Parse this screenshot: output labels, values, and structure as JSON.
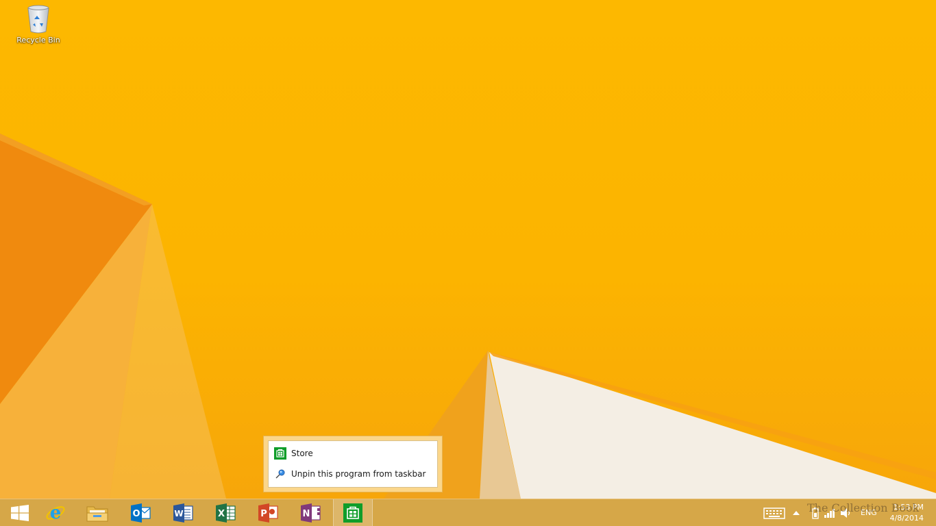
{
  "desktop": {
    "icons": [
      {
        "label": "Recycle Bin",
        "icon": "recycle-bin-icon"
      }
    ]
  },
  "jumplist": {
    "items": [
      {
        "label": "Store",
        "icon": "store-icon"
      },
      {
        "label": "Unpin this program from taskbar",
        "icon": "pin-icon"
      }
    ]
  },
  "taskbar": {
    "pinned": [
      {
        "name": "start",
        "icon": "windows-logo-icon"
      },
      {
        "name": "internet-explorer",
        "icon": "internet-explorer-icon",
        "glyph": "e"
      },
      {
        "name": "file-explorer",
        "icon": "folder-icon"
      },
      {
        "name": "outlook",
        "icon": "outlook-icon",
        "glyph": "O"
      },
      {
        "name": "word",
        "icon": "word-icon",
        "glyph": "W"
      },
      {
        "name": "excel",
        "icon": "excel-icon",
        "glyph": "X"
      },
      {
        "name": "powerpoint",
        "icon": "powerpoint-icon",
        "glyph": "P"
      },
      {
        "name": "onenote",
        "icon": "onenote-icon",
        "glyph": "N"
      },
      {
        "name": "store",
        "icon": "store-icon",
        "active": true
      }
    ],
    "tray": {
      "language": "ENG",
      "time": "1:53 PM",
      "date": "4/8/2014"
    }
  },
  "watermark": "The Collection Book",
  "colors": {
    "wallpaper": "#fcb400",
    "taskbar": "#d6a748",
    "outlook": "#0072c6",
    "word": "#2b579a",
    "excel": "#217346",
    "powerpoint": "#d24726",
    "onenote": "#80397b",
    "store": "#0f9d2a"
  }
}
